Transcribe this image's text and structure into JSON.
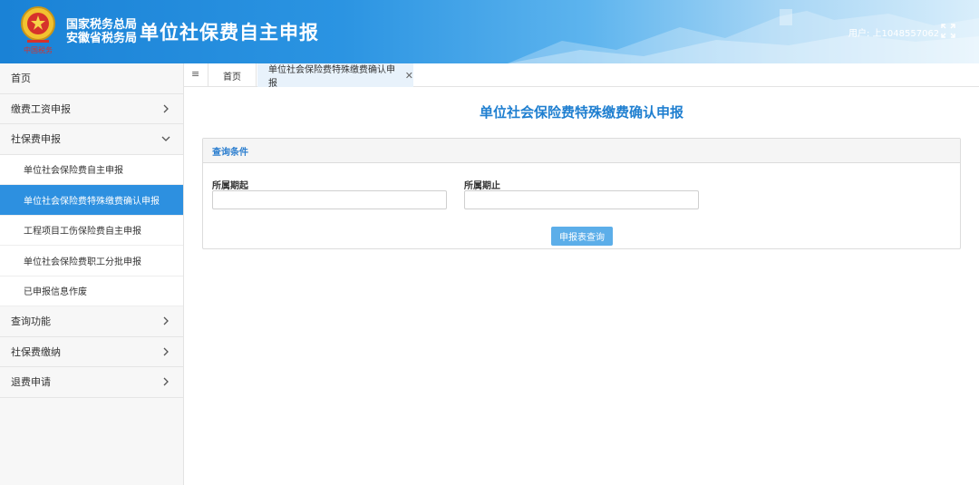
{
  "header": {
    "org_line1": "国家税务总局",
    "org_line2": "安徽省税务局",
    "app_title": "单位社保费自主申报",
    "user_label": "用户: 上1048557062",
    "emblem_text": "中国税务"
  },
  "sidebar": {
    "items": [
      {
        "label": "首页"
      },
      {
        "label": "缴费工资申报",
        "chevron": "right"
      },
      {
        "label": "社保费申报",
        "chevron": "down",
        "children": [
          {
            "label": "单位社会保险费自主申报"
          },
          {
            "label": "单位社会保险费特殊缴费确认申报",
            "active": true
          },
          {
            "label": "工程项目工伤保险费自主申报"
          },
          {
            "label": "单位社会保险费职工分批申报"
          },
          {
            "label": "已申报信息作废"
          }
        ]
      },
      {
        "label": "查询功能",
        "chevron": "right"
      },
      {
        "label": "社保费缴纳",
        "chevron": "right"
      },
      {
        "label": "退费申请",
        "chevron": "right"
      }
    ]
  },
  "tabs": {
    "menu_icon": "≡",
    "home": "首页",
    "current": "单位社会保险费特殊缴费确认申报",
    "close": "✕"
  },
  "main": {
    "heading": "单位社会保险费特殊缴费确认申报",
    "panel_title": "查询条件",
    "start_label": "所属期起",
    "end_label": "所属期止",
    "start_value": "",
    "end_value": "",
    "query_button": "申报表查询"
  },
  "colors": {
    "header_blue": "#1a82d6",
    "active_nav": "#2d90e0",
    "heading": "#1f7fd0",
    "button": "#5caee9"
  }
}
